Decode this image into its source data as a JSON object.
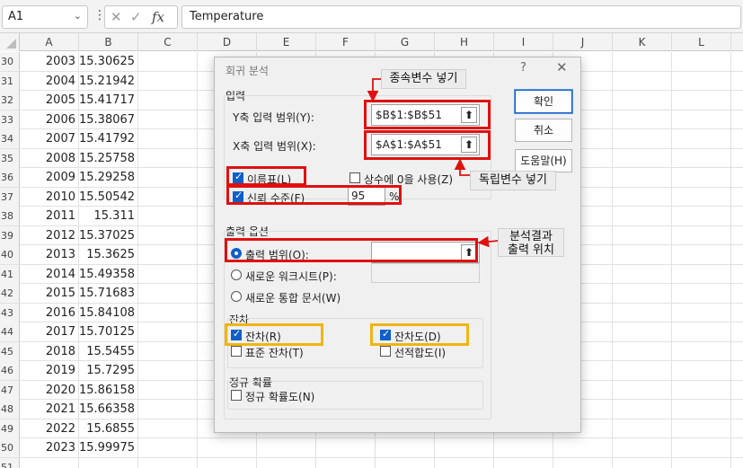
{
  "formula_bar": {
    "name_box": "A1",
    "cancel_icon": "✕",
    "enter_icon": "✓",
    "fx": "fx",
    "value": "Temperature"
  },
  "columns": [
    "A",
    "B",
    "C",
    "D",
    "E",
    "F",
    "G",
    "H",
    "I",
    "J",
    "K",
    "L"
  ],
  "rows": [
    {
      "n": "30",
      "a": "2003",
      "b": "15.30625"
    },
    {
      "n": "31",
      "a": "2004",
      "b": "15.21942"
    },
    {
      "n": "32",
      "a": "2005",
      "b": "15.41717"
    },
    {
      "n": "33",
      "a": "2006",
      "b": "15.38067"
    },
    {
      "n": "34",
      "a": "2007",
      "b": "15.41792"
    },
    {
      "n": "35",
      "a": "2008",
      "b": "15.25758"
    },
    {
      "n": "36",
      "a": "2009",
      "b": "15.29258"
    },
    {
      "n": "37",
      "a": "2010",
      "b": "15.50542"
    },
    {
      "n": "38",
      "a": "2011",
      "b": "15.311"
    },
    {
      "n": "39",
      "a": "2012",
      "b": "15.37025"
    },
    {
      "n": "40",
      "a": "2013",
      "b": "15.3625"
    },
    {
      "n": "41",
      "a": "2014",
      "b": "15.49358"
    },
    {
      "n": "42",
      "a": "2015",
      "b": "15.71683"
    },
    {
      "n": "43",
      "a": "2016",
      "b": "15.84108"
    },
    {
      "n": "44",
      "a": "2017",
      "b": "15.70125"
    },
    {
      "n": "45",
      "a": "2018",
      "b": "15.5455"
    },
    {
      "n": "46",
      "a": "2019",
      "b": "15.7295"
    },
    {
      "n": "47",
      "a": "2020",
      "b": "15.86158"
    },
    {
      "n": "48",
      "a": "2021",
      "b": "15.66358"
    },
    {
      "n": "49",
      "a": "2022",
      "b": "15.6855"
    },
    {
      "n": "50",
      "a": "2023",
      "b": "15.99975"
    },
    {
      "n": "51",
      "a": "",
      "b": ""
    }
  ],
  "dialog": {
    "title": "회귀 분석",
    "help": "?",
    "close": "✕",
    "input_group": "입력",
    "y_range_label": "Y축 입력 범위(Y):",
    "y_range_value": "$B$1:$B$51",
    "x_range_label": "X축 입력 범위(X):",
    "x_range_value": "$A$1:$A$51",
    "upload_icon": "⬆",
    "labels_check": "이름표(L)",
    "labels_checked": true,
    "constant_zero": "상수에 0을 사용(Z)",
    "constant_zero_checked": false,
    "confidence_check": "신뢰 수준(F)",
    "confidence_checked": true,
    "confidence_value": "95",
    "percent": "%",
    "ok": "확인",
    "cancel": "취소",
    "help_button": "도움말(H)",
    "output_group": "출력 옵션",
    "output_range": "출력 범위(O):",
    "output_range_value": "",
    "new_worksheet": "새로운 워크시트(P):",
    "new_workbook": "새로운 통합 문서(W)",
    "residuals_group": "잔차",
    "residuals": "잔차(R)",
    "residuals_checked": true,
    "standardized_residuals": "표준 잔차(T)",
    "standardized_checked": false,
    "residual_plots": "잔차도(D)",
    "residual_plots_checked": true,
    "line_fit_plots": "선적합도(I)",
    "line_fit_checked": false,
    "normal_group": "정규 확률",
    "normal_plots": "정규 확률도(N)",
    "normal_checked": false
  },
  "annotations": {
    "dependent": "종속변수 넣기",
    "independent": "독립변수 넣기",
    "output_line1": "분석결과",
    "output_line2": "출력 위치"
  },
  "colors": {
    "highlight_red": "#e01010",
    "highlight_yellow": "#f0b414",
    "accent_blue": "#0f5fc8"
  }
}
